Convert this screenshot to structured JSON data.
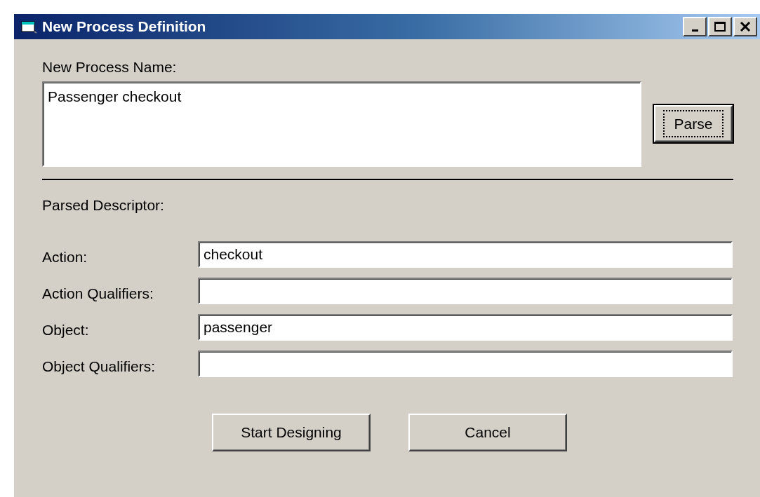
{
  "window": {
    "title": "New Process Definition"
  },
  "process_name": {
    "label": "New Process Name:",
    "value": "Passenger checkout"
  },
  "parse_button": {
    "label": "Parse",
    "focused": true
  },
  "descriptor": {
    "heading": "Parsed Descriptor:",
    "fields": [
      {
        "label": "Action:",
        "value": "checkout"
      },
      {
        "label": "Action Qualifiers:"
      },
      {
        "label": "Object:",
        "value": "passenger"
      },
      {
        "label": "Object Qualifiers:"
      }
    ]
  },
  "buttons": [
    {
      "label": "Start Designing"
    },
    {
      "label": "Cancel"
    }
  ]
}
